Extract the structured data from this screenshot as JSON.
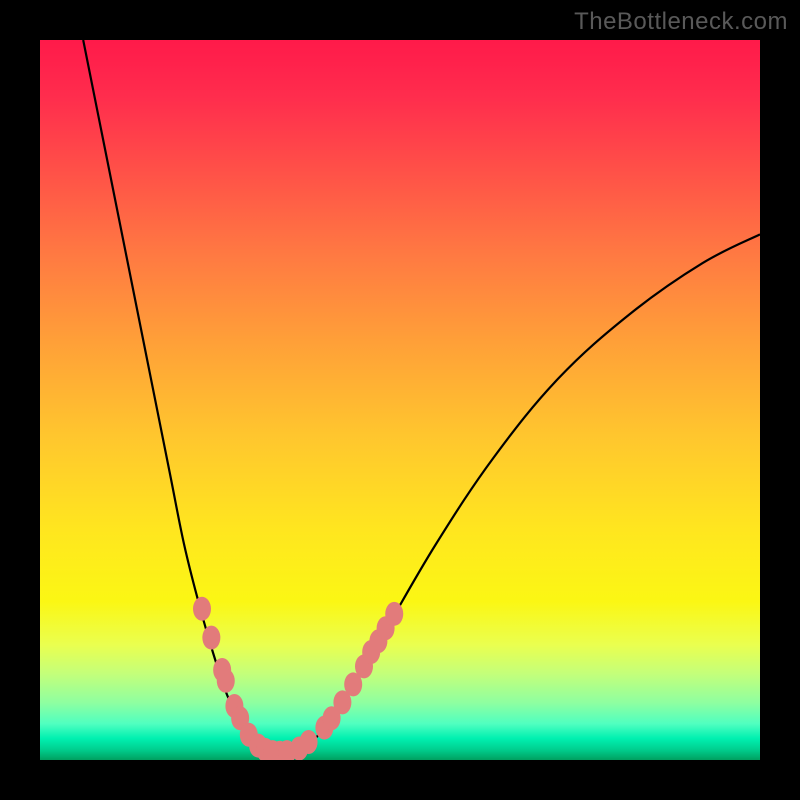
{
  "attribution": "TheBottleneck.com",
  "chart_data": {
    "type": "line",
    "title": "",
    "xlabel": "",
    "ylabel": "",
    "xlim": [
      0,
      100
    ],
    "ylim": [
      0,
      100
    ],
    "left_curve": [
      {
        "x": 6,
        "y": 100
      },
      {
        "x": 9,
        "y": 85
      },
      {
        "x": 12,
        "y": 70
      },
      {
        "x": 15,
        "y": 55
      },
      {
        "x": 18,
        "y": 40
      },
      {
        "x": 20,
        "y": 30
      },
      {
        "x": 22,
        "y": 22
      },
      {
        "x": 24,
        "y": 15
      },
      {
        "x": 26,
        "y": 9
      },
      {
        "x": 28,
        "y": 5
      },
      {
        "x": 30,
        "y": 2.5
      },
      {
        "x": 32,
        "y": 1.3
      },
      {
        "x": 33,
        "y": 1
      }
    ],
    "right_curve": [
      {
        "x": 33,
        "y": 1
      },
      {
        "x": 35,
        "y": 1.2
      },
      {
        "x": 37,
        "y": 2
      },
      {
        "x": 40,
        "y": 5
      },
      {
        "x": 44,
        "y": 11
      },
      {
        "x": 48,
        "y": 18
      },
      {
        "x": 55,
        "y": 30
      },
      {
        "x": 63,
        "y": 42
      },
      {
        "x": 72,
        "y": 53
      },
      {
        "x": 82,
        "y": 62
      },
      {
        "x": 92,
        "y": 69
      },
      {
        "x": 100,
        "y": 73
      }
    ],
    "dot_series_left": [
      {
        "x": 22.5,
        "y": 21
      },
      {
        "x": 23.8,
        "y": 17
      },
      {
        "x": 25.3,
        "y": 12.5
      },
      {
        "x": 25.8,
        "y": 11
      },
      {
        "x": 27.0,
        "y": 7.5
      },
      {
        "x": 27.8,
        "y": 5.8
      },
      {
        "x": 29.0,
        "y": 3.5
      },
      {
        "x": 30.3,
        "y": 2.0
      },
      {
        "x": 31.3,
        "y": 1.4
      },
      {
        "x": 32.3,
        "y": 1.1
      },
      {
        "x": 33.3,
        "y": 1.0
      },
      {
        "x": 34.3,
        "y": 1.1
      }
    ],
    "dot_series_right": [
      {
        "x": 36.0,
        "y": 1.6
      },
      {
        "x": 37.3,
        "y": 2.5
      },
      {
        "x": 39.5,
        "y": 4.5
      },
      {
        "x": 40.5,
        "y": 5.8
      },
      {
        "x": 42.0,
        "y": 8.0
      },
      {
        "x": 43.5,
        "y": 10.5
      },
      {
        "x": 45.0,
        "y": 13.0
      },
      {
        "x": 46.0,
        "y": 15.0
      },
      {
        "x": 47.0,
        "y": 16.5
      },
      {
        "x": 48.0,
        "y": 18.3
      },
      {
        "x": 49.2,
        "y": 20.3
      }
    ],
    "dot_color": "#e27b7b",
    "curve_color": "#000000"
  }
}
